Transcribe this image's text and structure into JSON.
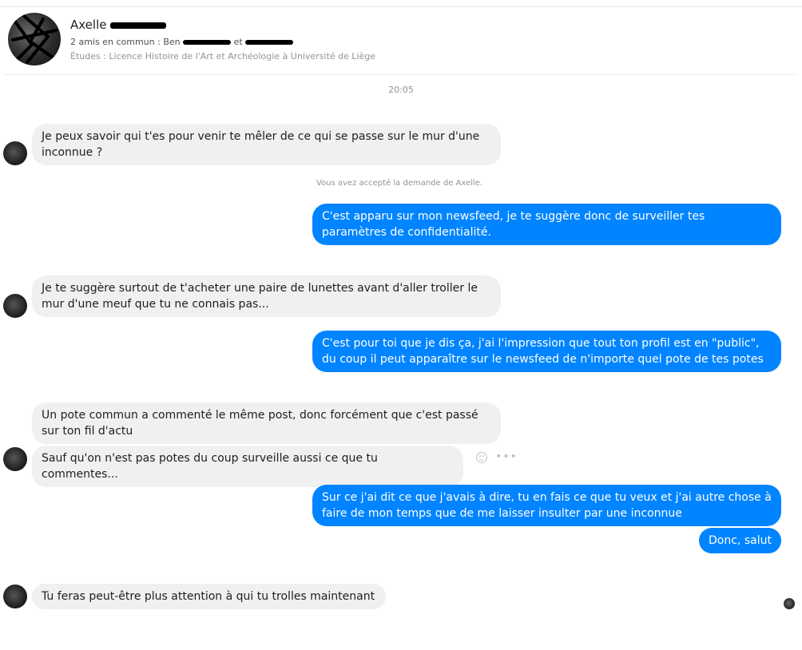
{
  "header": {
    "name": "Axelle",
    "mutual_friends": "2 amis en commun : Ben",
    "mutual_friends_tail": "et",
    "studies": "Études : Licence Histoire de l'Art et Archéologie à Université de Liège"
  },
  "conversation": {
    "timestamp": "20:05",
    "system_message": "Vous avez accepté la demande de Axelle.",
    "messages": [
      {
        "from": "them",
        "text": "Je peux savoir qui t'es pour venir te mêler de ce qui se passe sur le mur d'une inconnue ?"
      },
      {
        "from": "me",
        "text": "C'est apparu sur mon newsfeed, je te suggère donc de surveiller tes paramètres de confidentialité."
      },
      {
        "from": "them",
        "text": "Je te suggère surtout de t'acheter une paire de lunettes avant d'aller troller le mur d'une meuf que tu ne connais pas..."
      },
      {
        "from": "me",
        "text": "C'est pour toi que je dis ça, j'ai l'impression que tout ton profil est en \"public\", du coup il peut apparaître sur le newsfeed de n'importe quel pote de tes potes"
      },
      {
        "from": "them",
        "text": "Un pote commun a commenté le même post, donc forcément que c'est passé sur ton fil d'actu"
      },
      {
        "from": "them",
        "text": "Sauf qu'on n'est pas potes du coup surveille aussi ce que tu commentes..."
      },
      {
        "from": "me",
        "text": "Sur ce j'ai dit ce que j'avais à dire, tu en fais ce que tu veux et j'ai autre chose à faire de mon temps que de me laisser insulter par une inconnue"
      },
      {
        "from": "me",
        "text": "Donc, salut"
      },
      {
        "from": "them",
        "text": "Tu feras peut-être plus attention à qui tu trolles maintenant"
      }
    ]
  },
  "icons": {
    "emoji": "emoji-icon",
    "more": "more-options-icon",
    "more_glyph": "•••"
  },
  "colors": {
    "outgoing_bubble": "#0084ff",
    "incoming_bubble": "#f1f0f0"
  }
}
